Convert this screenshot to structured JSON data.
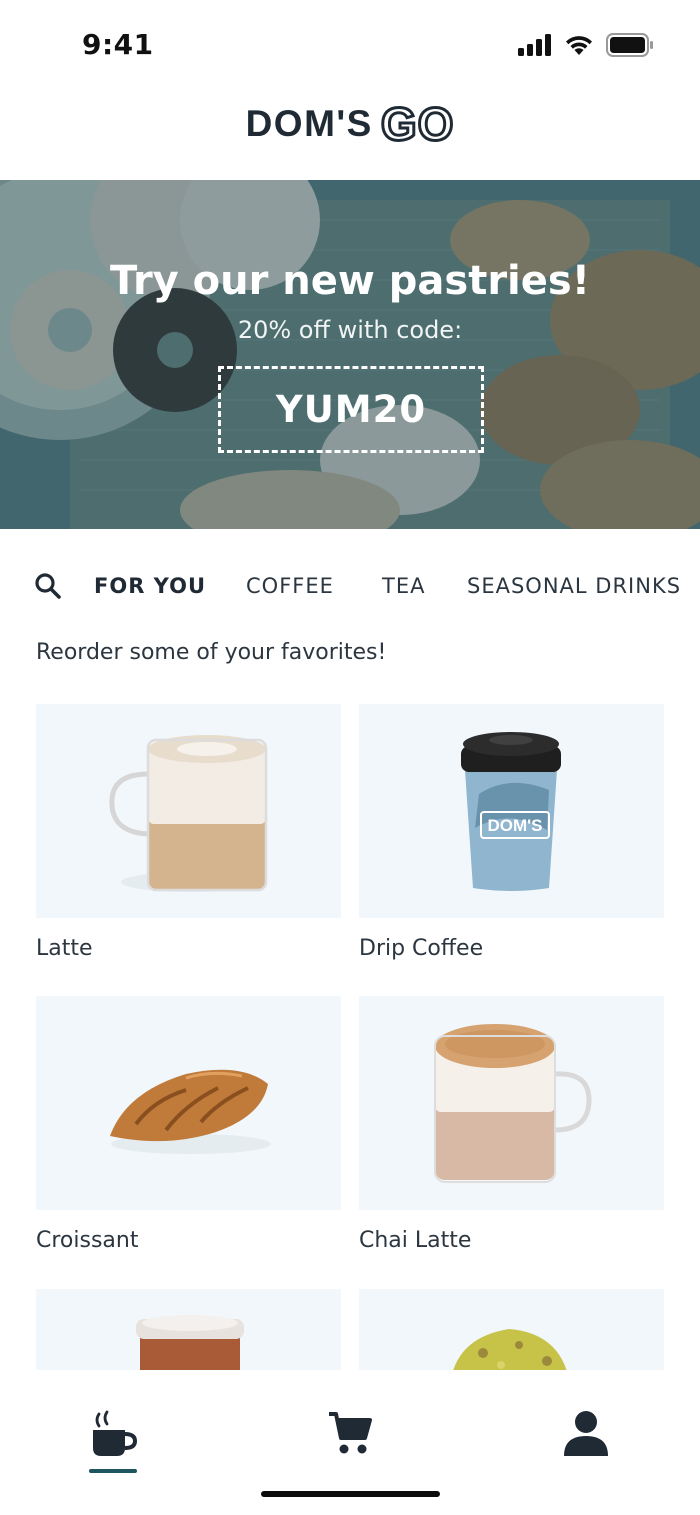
{
  "status_bar": {
    "time": "9:41"
  },
  "header": {
    "logo_text": "DOM'S",
    "logo_suffix": "GO"
  },
  "promo": {
    "title": "Try our new pastries!",
    "subtitle": "20% off with code:",
    "code": "YUM20"
  },
  "categories": {
    "search_icon": "search-icon",
    "tabs": [
      {
        "label": "FOR YOU",
        "active": true
      },
      {
        "label": "COFFEE",
        "active": false
      },
      {
        "label": "TEA",
        "active": false
      },
      {
        "label": "SEASONAL DRINKS",
        "active": false
      }
    ]
  },
  "favorites": {
    "heading": "Reorder some of your favorites!",
    "items": [
      {
        "name": "Latte",
        "icon": "latte-glass-image"
      },
      {
        "name": "Drip Coffee",
        "icon": "drip-coffee-cup-image"
      },
      {
        "name": "Croissant",
        "icon": "croissant-image"
      },
      {
        "name": "Chai Latte",
        "icon": "chai-latte-mug-image"
      },
      {
        "name": "",
        "icon": "iced-tea-cup-image"
      },
      {
        "name": "",
        "icon": "matcha-pastry-image"
      }
    ]
  },
  "tab_bar": {
    "items": [
      {
        "icon": "coffee-cup-icon",
        "active": true
      },
      {
        "icon": "cart-icon",
        "active": false
      },
      {
        "icon": "user-icon",
        "active": false
      }
    ]
  },
  "colors": {
    "accent": "#1f5560",
    "text": "#1f2a35",
    "card_bg": "#f1f7fb"
  }
}
